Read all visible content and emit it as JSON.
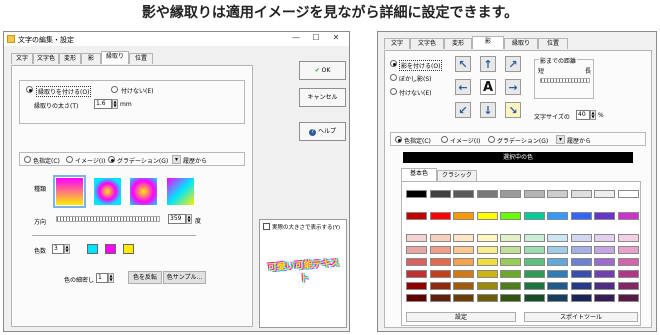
{
  "headline": "影や縁取りは適用イメージを見ながら詳細に設定できます。",
  "left_window": {
    "title": "文字の編集・設定",
    "controls": [
      "—",
      "☐",
      "✕"
    ],
    "tabs": [
      "文字",
      "文字色",
      "変形",
      "影",
      "縁取り",
      "位置"
    ],
    "active_tab": "縁取り",
    "border": {
      "opt_on": "縁取りを付ける(O)",
      "opt_off": "付けない(E)",
      "width_label": "縁取りの太さ(T)",
      "width_value": "1.6",
      "width_unit": "mm"
    },
    "color_mode": {
      "opt_color": "色指定(C)",
      "opt_image": "イメージ(I)",
      "opt_gradient": "グラデーション(G)",
      "history_btn": "▾",
      "history_label": "履歴から"
    },
    "type_label": "種類",
    "direction_label": "方向",
    "direction_value": "359",
    "direction_unit": "度",
    "colors_label": "色数",
    "colors_value": "3",
    "swatch_colors": [
      "#00e5ff",
      "#ff00ff",
      "#ffee00"
    ],
    "fine_label": "色の細密し",
    "fine_value": "1",
    "invert_btn": "色を反転",
    "sample_btn": "色サンプル...",
    "ok_btn": "OK",
    "cancel_btn": "キャンセル",
    "help_btn": "ヘルプ",
    "preview_checkbox": "実際の大きさで表示する(Y)",
    "preview_text": "可愛い可能テキスト"
  },
  "right_window": {
    "tabs": [
      "文字",
      "文字色",
      "変形",
      "影",
      "縁取り",
      "位置"
    ],
    "active_tab": "影",
    "shadow": {
      "opt_on": "影を付ける(O)",
      "opt_blur": "ぼかし影(S)",
      "opt_off": "付けない(E)"
    },
    "distance_group": "影までの距離",
    "short_label": "短",
    "long_label": "長",
    "size_label": "文字サイズの",
    "size_value": "40",
    "size_unit": "%",
    "center_glyph": "A",
    "color_mode": {
      "opt_color": "色指定(C)",
      "opt_image": "イメージ(I)",
      "opt_gradient": "グラデーション(G)",
      "history_btn": "▾",
      "history_label": "履歴から"
    },
    "selected_color_label": "選択中の色",
    "palette_tabs": [
      "基本色",
      "クラシック"
    ],
    "settings_btn": "設定",
    "eyedropper_btn": "スポイトツール",
    "gray_row": [
      "#000000",
      "#404040",
      "#5a5a5a",
      "#7a7a7a",
      "#9a9a9a",
      "#b4b4b4",
      "#cccccc",
      "#dedede",
      "#eeeeee",
      "#ffffff"
    ],
    "vivid_row": [
      "#c00000",
      "#ff0000",
      "#ff9900",
      "#ffff00",
      "#66ff00",
      "#00cc99",
      "#3399ff",
      "#3366ff",
      "#6633cc",
      "#cc33cc"
    ],
    "palette_cols": [
      [
        "#f2d4d4",
        "#e6a6a6",
        "#d86060",
        "#c03030",
        "#900000",
        "#600000"
      ],
      [
        "#f7d0c0",
        "#ee9f8a",
        "#e26a4f",
        "#c0401e",
        "#902a10",
        "#602010"
      ],
      [
        "#fde6c8",
        "#f8c890",
        "#f2a34b",
        "#d07b16",
        "#a05a0a",
        "#6a3d06"
      ],
      [
        "#fdf6c3",
        "#f8ec8e",
        "#f0dd42",
        "#c9b412",
        "#988a08",
        "#6a5f06"
      ],
      [
        "#e1f0c8",
        "#c3e09a",
        "#9ccc58",
        "#6ea82a",
        "#4e7e1a",
        "#345412"
      ],
      [
        "#cdeed6",
        "#9cdcae",
        "#5ec080",
        "#2e9a56",
        "#1f7340",
        "#154d2b"
      ],
      [
        "#cfe6f2",
        "#a0cce6",
        "#62a8d8",
        "#2e7cb8",
        "#1f5a8a",
        "#153d5c"
      ],
      [
        "#d2d8f2",
        "#a5b1e4",
        "#6e80d0",
        "#3a4eb0",
        "#283884",
        "#1b2658"
      ],
      [
        "#e2d2f0",
        "#c4a6e2",
        "#9c6ccd",
        "#7040b0",
        "#502c84",
        "#361d58"
      ],
      [
        "#f2d0e6",
        "#e4a2cc",
        "#d066aa",
        "#b03688",
        "#842664",
        "#581a44"
      ]
    ]
  }
}
